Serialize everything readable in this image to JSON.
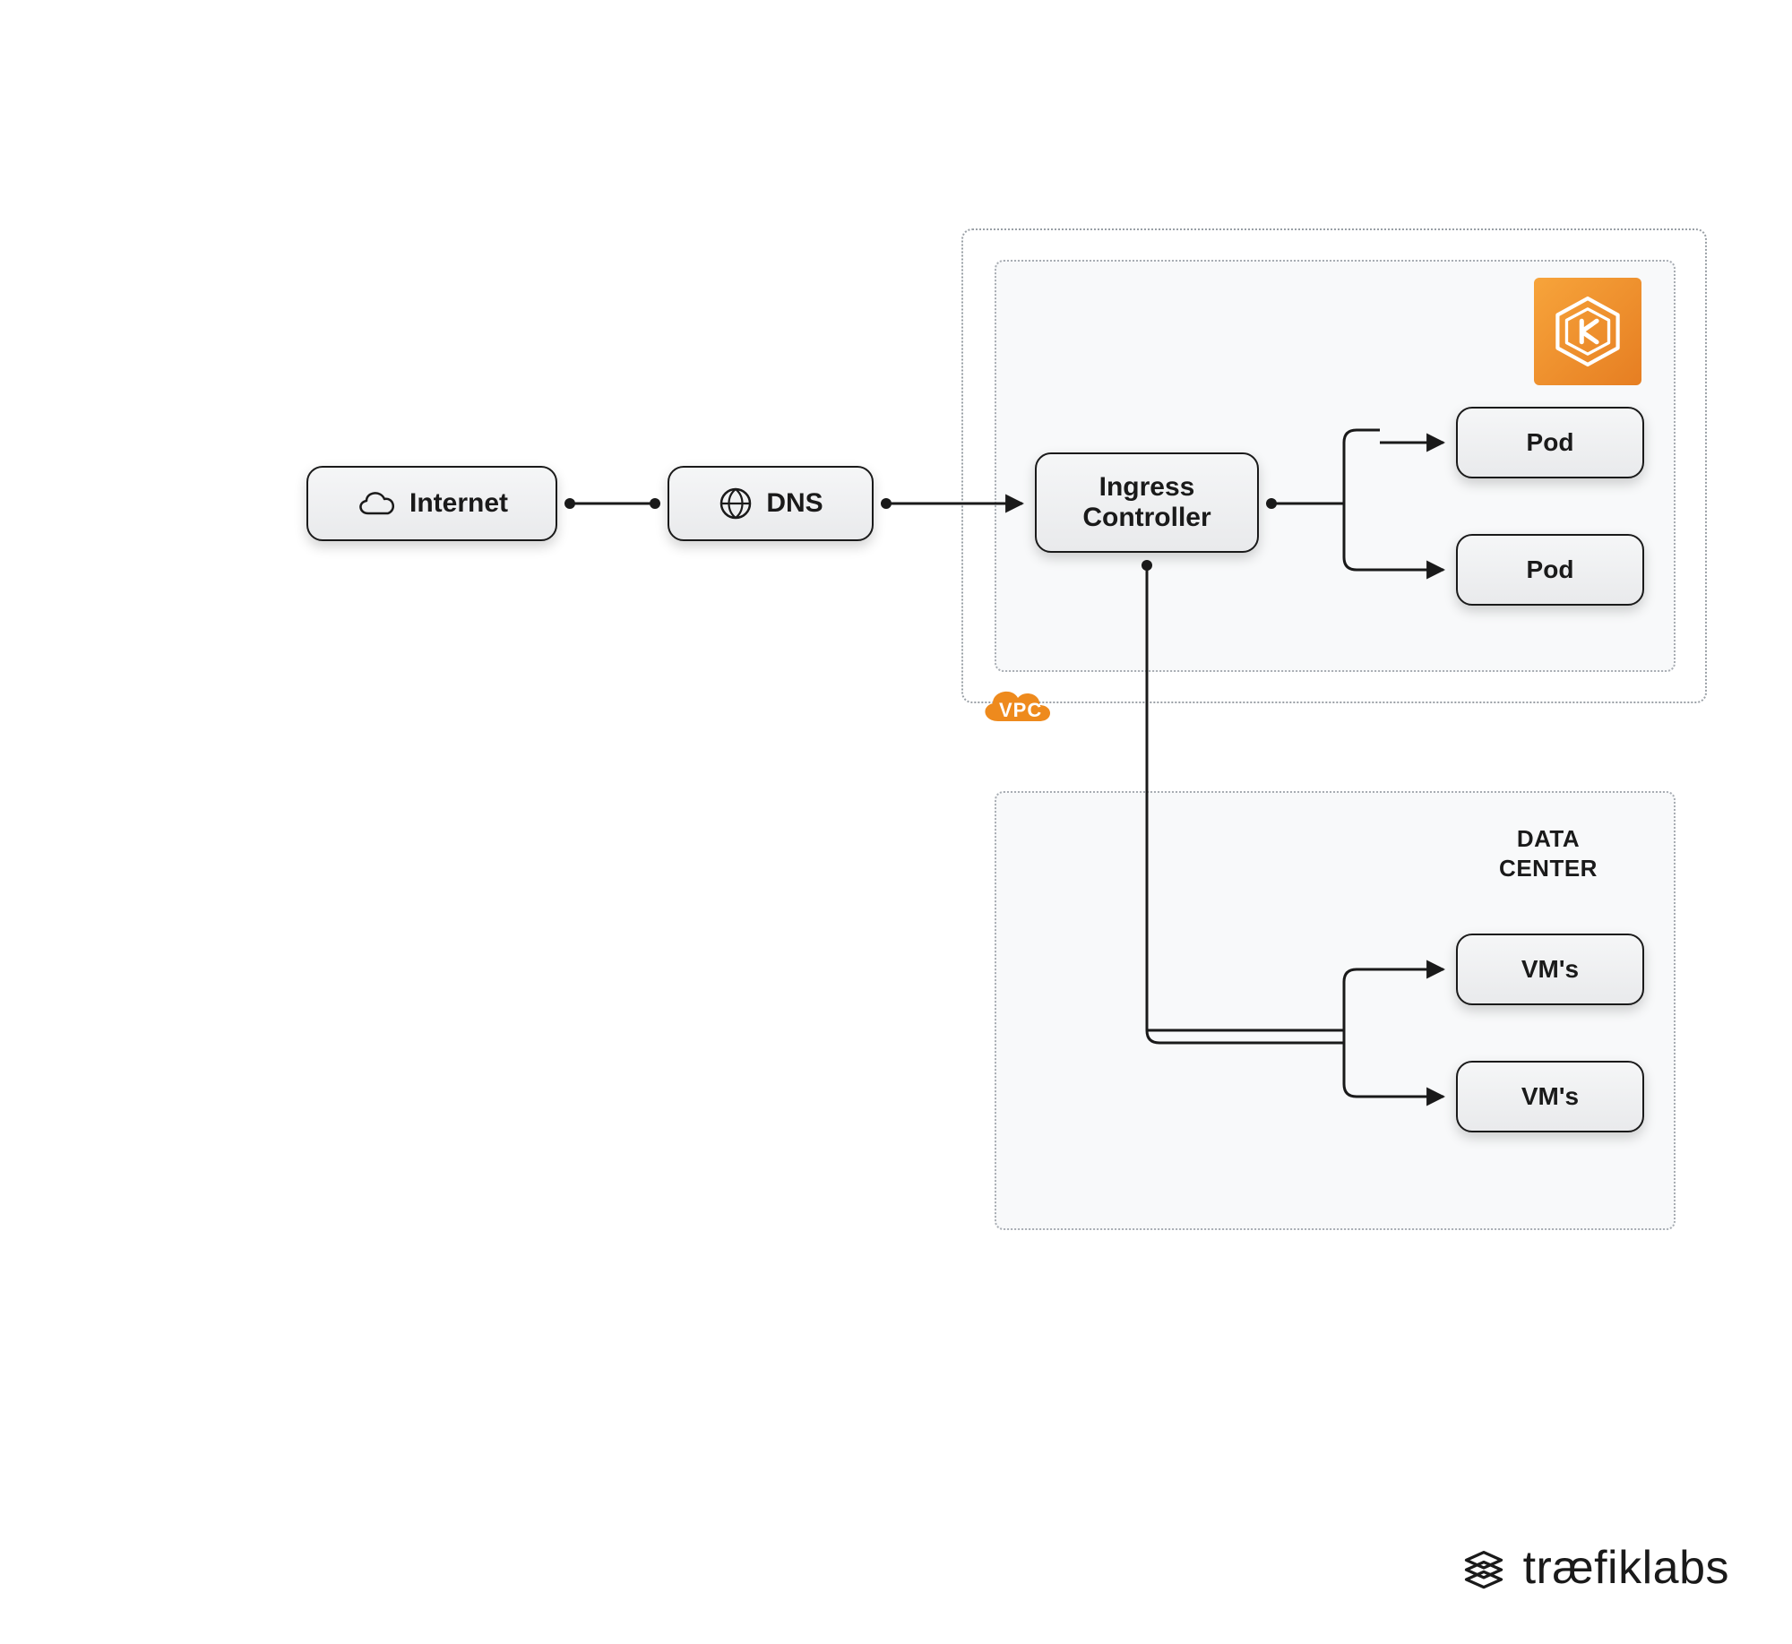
{
  "nodes": {
    "internet": "Internet",
    "dns": "DNS",
    "ingress_line1": "Ingress",
    "ingress_line2": "Controller",
    "pod1": "Pod",
    "pod2": "Pod",
    "vm1": "VM's",
    "vm2": "VM's"
  },
  "containers": {
    "vpc": "VPC",
    "datacenter_line1": "DATA",
    "datacenter_line2": "CENTER"
  },
  "brand": {
    "name": "træfiklabs"
  },
  "colors": {
    "accent_orange": "#ee8a1d",
    "node_border": "#1a1a1a",
    "dash": "#9aa0a6"
  }
}
